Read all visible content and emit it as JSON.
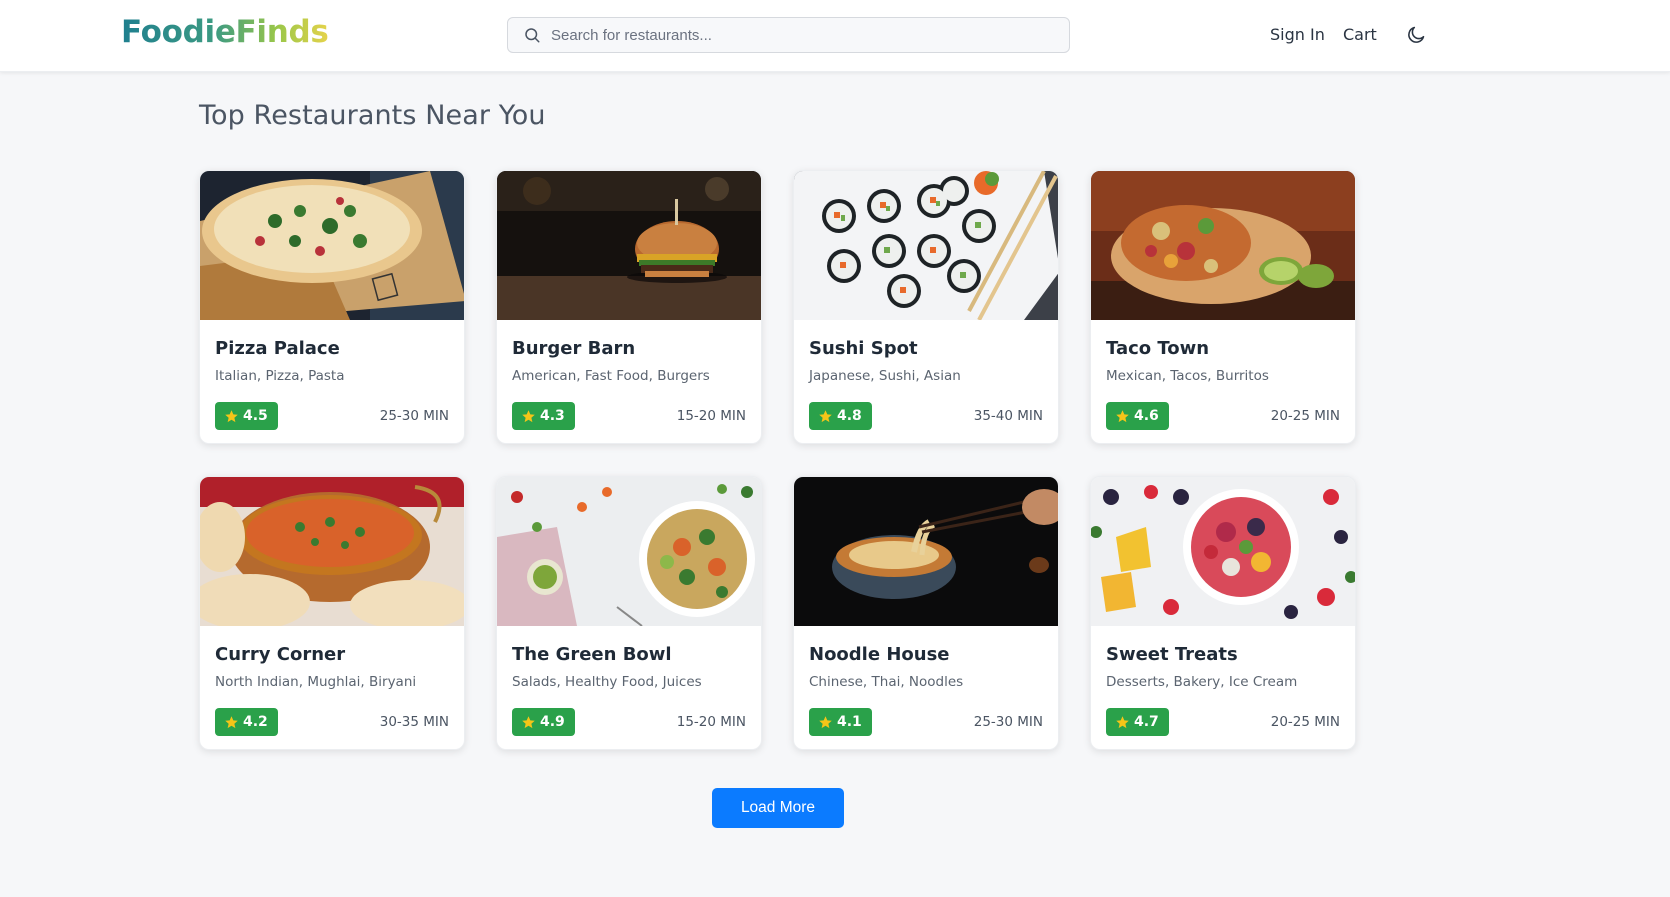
{
  "header": {
    "logo": "FoodieFinds",
    "search": {
      "placeholder": "Search for restaurants...",
      "value": ""
    },
    "sign_in": "Sign In",
    "cart": "Cart",
    "theme_icon": "moon-icon"
  },
  "main": {
    "title": "Top Restaurants Near You",
    "restaurants": [
      {
        "name": "Pizza Palace",
        "cuisine": "Italian, Pizza, Pasta",
        "rating": "4.5",
        "time": "25-30 MIN",
        "image": "pizza"
      },
      {
        "name": "Burger Barn",
        "cuisine": "American, Fast Food, Burgers",
        "rating": "4.3",
        "time": "15-20 MIN",
        "image": "burger"
      },
      {
        "name": "Sushi Spot",
        "cuisine": "Japanese, Sushi, Asian",
        "rating": "4.8",
        "time": "35-40 MIN",
        "image": "sushi"
      },
      {
        "name": "Taco Town",
        "cuisine": "Mexican, Tacos, Burritos",
        "rating": "4.6",
        "time": "20-25 MIN",
        "image": "burrito"
      },
      {
        "name": "Curry Corner",
        "cuisine": "North Indian, Mughlai, Biryani",
        "rating": "4.2",
        "time": "30-35 MIN",
        "image": "curry"
      },
      {
        "name": "The Green Bowl",
        "cuisine": "Salads, Healthy Food, Juices",
        "rating": "4.9",
        "time": "15-20 MIN",
        "image": "salad"
      },
      {
        "name": "Noodle House",
        "cuisine": "Chinese, Thai, Noodles",
        "rating": "4.1",
        "time": "25-30 MIN",
        "image": "noodles"
      },
      {
        "name": "Sweet Treats",
        "cuisine": "Desserts, Bakery, Ice Cream",
        "rating": "4.7",
        "time": "20-25 MIN",
        "image": "fruit-bowl"
      }
    ],
    "load_more": "Load More"
  },
  "colors": {
    "rating_badge": "#2aa14a",
    "primary_button": "#0b7bff",
    "star": "#f5c518",
    "background": "#f6f7f9"
  }
}
